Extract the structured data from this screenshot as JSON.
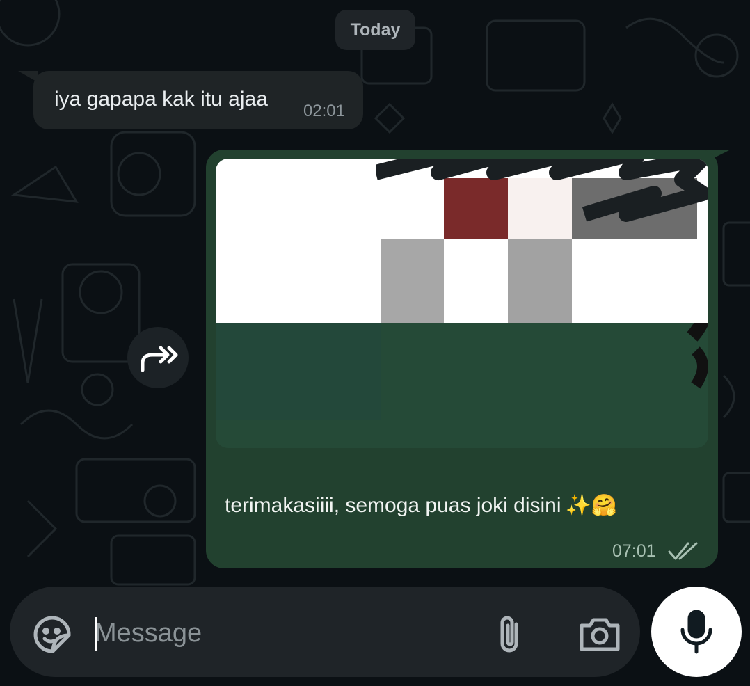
{
  "chat": {
    "date_separator": "Today",
    "messages": [
      {
        "direction": "incoming",
        "text": "iya gapapa kak itu ajaa",
        "time": "02:01"
      },
      {
        "direction": "outgoing",
        "text": "terimakasiiii, semoga puas joki disini",
        "emoji": "✨🤗",
        "time": "07:01",
        "status": "read"
      }
    ]
  },
  "composer": {
    "placeholder": "Message"
  },
  "icons": {
    "forward": "forward-icon",
    "sticker": "sticker-icon",
    "attach": "paperclip-icon",
    "camera": "camera-icon",
    "mic": "microphone-icon",
    "ticks": "double-check-icon"
  },
  "colors": {
    "background": "#0b1014",
    "incoming_bubble": "#1f2426",
    "outgoing_bubble": "#22412f",
    "accent_red": "#7a2a2a"
  }
}
